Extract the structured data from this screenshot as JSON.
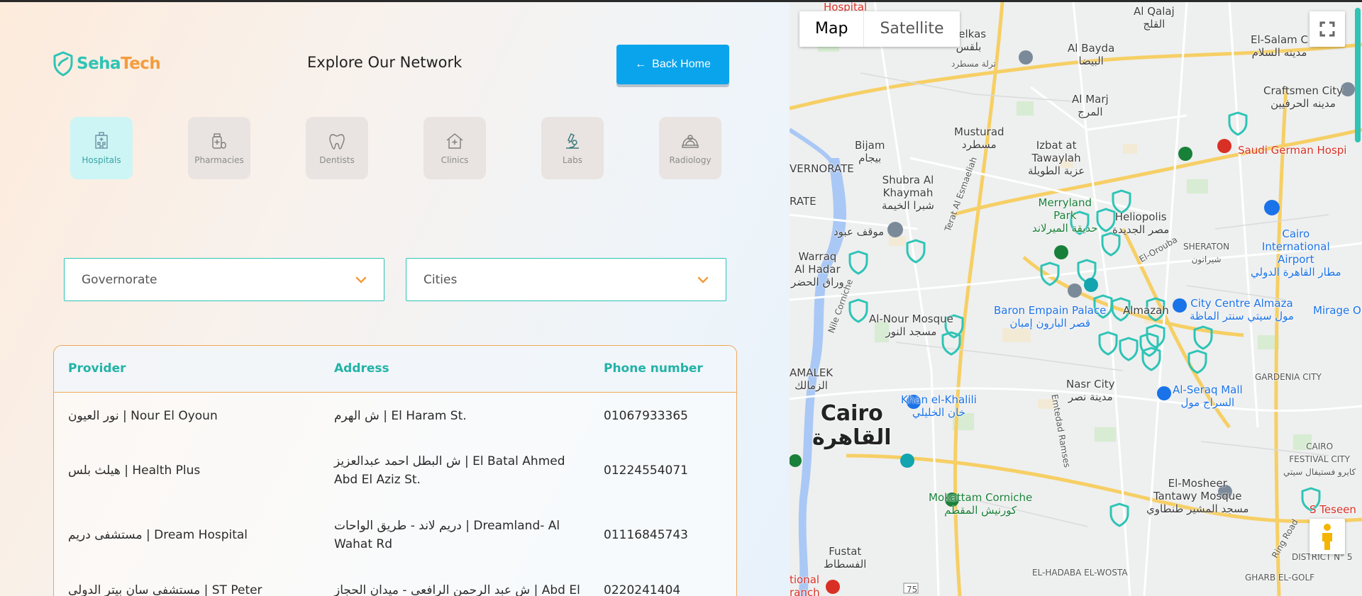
{
  "brand": {
    "name_part1": "Seha",
    "name_part2": "Tech"
  },
  "page_title": "Explore Our Network",
  "back_button": {
    "arrow": "←",
    "label": "Back Home"
  },
  "categories": [
    {
      "label": "Hospitals",
      "icon": "hospital-icon",
      "active": true
    },
    {
      "label": "Pharmacies",
      "icon": "pharmacy-icon",
      "active": false
    },
    {
      "label": "Dentists",
      "icon": "tooth-icon",
      "active": false
    },
    {
      "label": "Clinics",
      "icon": "clinic-icon",
      "active": false
    },
    {
      "label": "Labs",
      "icon": "microscope-icon",
      "active": false
    },
    {
      "label": "Radiology",
      "icon": "radiology-icon",
      "active": false
    }
  ],
  "filters": {
    "governorate": {
      "placeholder": "Governorate"
    },
    "cities": {
      "placeholder": "Cities"
    }
  },
  "table": {
    "headers": {
      "provider": "Provider",
      "address": "Address",
      "phone": "Phone number"
    },
    "rows": [
      {
        "provider": "نور العيون | Nour El Oyoun",
        "address_1": "ش الهرم | El Haram St.",
        "address_2": "",
        "phone": "01067933365"
      },
      {
        "provider": "هيلث بلس | Health Plus",
        "address_1": "ش البطل احمد عبدالعزيز | El Batal Ahmed",
        "address_2": "Abd El Aziz St.",
        "phone": "01224554071"
      },
      {
        "provider": "مستشفى دريم | Dream Hospital",
        "address_1": "دريم لاند - طريق الواحات | Dreamland- Al",
        "address_2": "Wahat Rd",
        "phone": "01116845743"
      },
      {
        "provider": "مستشفى سان بيتر الدولى | ST Peter",
        "address_1": "ش عبد الرحمن الرافعي - ميدان الحجاز | Abd El",
        "address_2": "",
        "phone": "0220241404"
      }
    ]
  },
  "map": {
    "type_options": [
      "Map",
      "Satellite"
    ],
    "selected_type": "Map",
    "labels": {
      "hospital_top": "Hospital",
      "belkas_en": "Belkas",
      "belkas_ar": "بلقس",
      "belkas_station": "ترلة مسطرد",
      "al_qalaj_en": "Al Qalaj",
      "al_qalaj_ar": "القلج",
      "al_bayda_en": "Al Bayda",
      "al_bayda_ar": "البيضا",
      "el_salam_en": "El-Salam C",
      "el_salam_ar": "مدينه السلام",
      "al_marj_en": "Al Marj",
      "al_marj_ar": "المرج",
      "craftsmen_en": "Craftsmen City",
      "craftsmen_ar": "مدينه الحرفيين",
      "mustarad_en": "Musturad",
      "mustarad_ar": "مسطرد",
      "bijam_en": "Bijam",
      "bijam_ar": "بيجام",
      "izbat_en": "Izbat at Tawaylah",
      "izbat_ar": "عزبة الطويلة",
      "saudi_german": "Saudi German Hospi",
      "shubra_en": "Shubra Al Khaymah",
      "shubra_ar": "شبرا الخيمة",
      "governorate_1": "VERNORATE",
      "governorate_2": "RATE",
      "merryland_en": "Merryland Park",
      "merryland_ar": "حديقة الميرلاند",
      "heliopolis_en": "Heliopolis",
      "heliopolis_ar": "مصر الجديدة",
      "cairo_airport_en": "Cairo International Airport",
      "cairo_airport_ar": "مطار القاهرة الدولي",
      "sheraton_en": "SHERATON",
      "sheraton_ar": "شيراتون",
      "mawqaf": "موقف عبود",
      "warraq_en": "Warraq Al Hadar",
      "warraq_ar": "وراق الحضر",
      "baron_en": "Baron Empain Palace",
      "baron_ar": "قصر البارون إمبان",
      "almazah": "Almazah",
      "city_centre_en": "City Centre Almaza",
      "city_centre_ar": "مول سيتي سنتر الماظة",
      "mirage": "Mirage Ou",
      "al_nour_en": "Al-Nour Mosque",
      "al_nour_ar": "مسجد النور",
      "amalek_en": "AMALEK",
      "amalek_ar": "الزمالك",
      "nasr_en": "Nasr City",
      "nasr_ar": "مدينة نصر",
      "al_seraq_en": "Al-Seraq Mall",
      "al_seraq_ar": "السراج مول",
      "gardenia": "GARDENIA CITY",
      "khan_en": "Khan el-Khalili",
      "khan_ar": "خان الخليلي",
      "cairo_en": "Cairo",
      "cairo_ar": "القاهرة",
      "cairo_festival_en": "CAIRO FESTIVAL CITY",
      "cairo_festival_ar": "كايرو فستيفال سيتي",
      "mokattam_en": "Mokattam Corniche",
      "mokattam_ar": "كورنيش المقطم",
      "el_mosheer_en": "El-Mosheer Tantawy Mosque",
      "el_mosheer_ar": "مسجد المشير طنطاوي",
      "s_teseen": "S Teseen",
      "fustat_en": "Fustat",
      "fustat_ar": "الفسطاط",
      "el_hadaba": "EL-HADABA EL-WOSTA",
      "district_5": "DISTRICT N° 5",
      "gharb": "GHARB EL-GOLF",
      "road_75": "75",
      "ring_road": "Ring Road",
      "emtedad_ramses": "Emtedad Ramses",
      "el_orouba": "El-Orouba",
      "nile_corniche": "Nile Corniche",
      "terat_ismailia": "Terat Al Esmaeliah",
      "national_branch": "tional ranch"
    }
  }
}
